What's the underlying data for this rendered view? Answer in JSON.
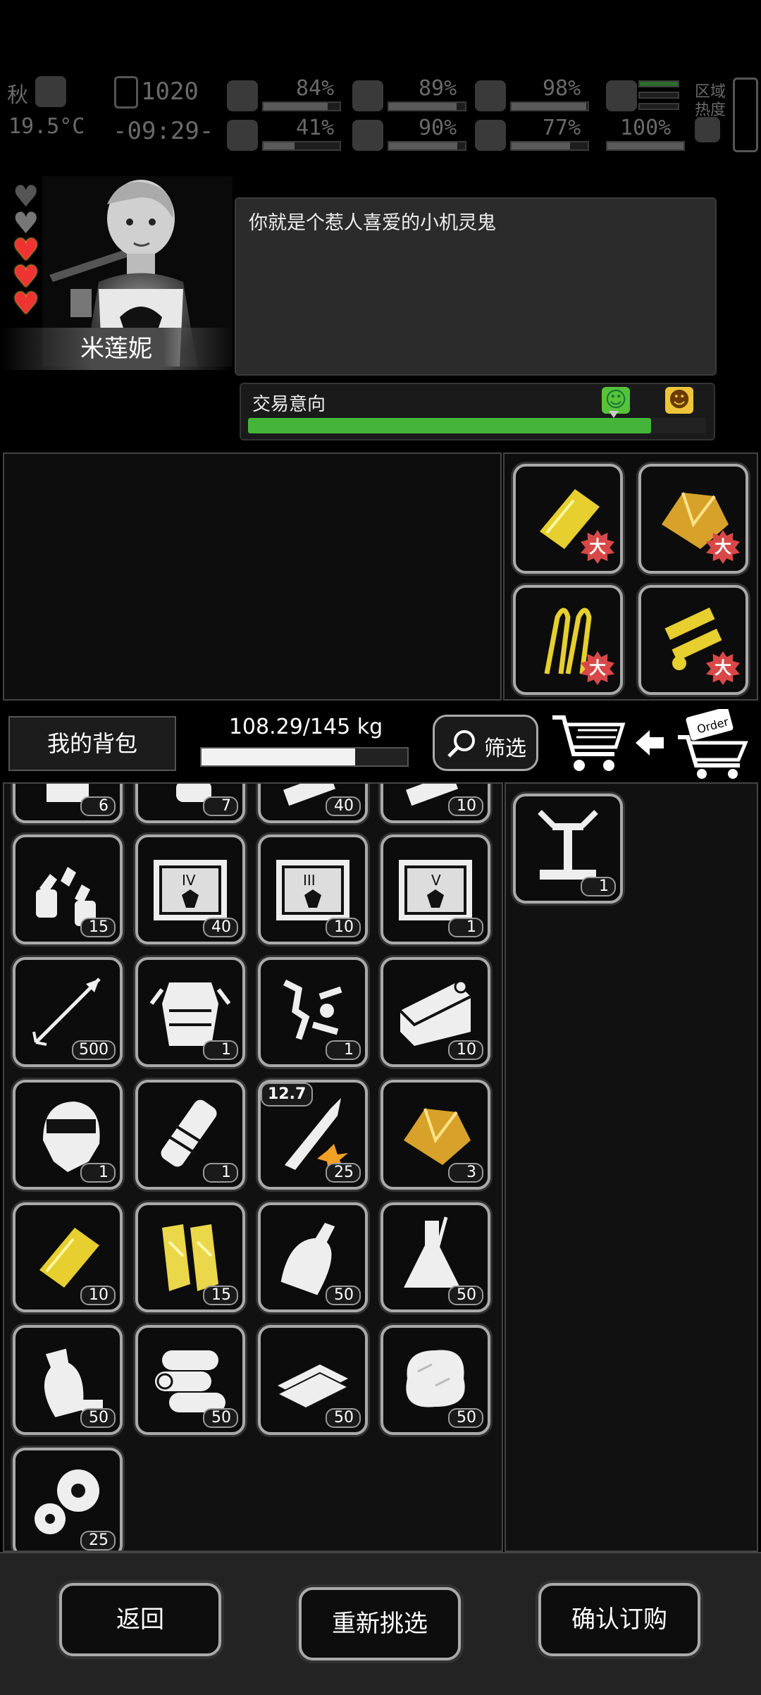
{
  "status": {
    "season": "秋",
    "time_digits": "1020",
    "temperature": "19.5°C",
    "clock": "-09:29-",
    "stats_top": [
      "84%",
      "89%",
      "98%"
    ],
    "stats_bottom": [
      "41%",
      "90%",
      "77%",
      "100%"
    ],
    "area_heat_label": "区域\n热度"
  },
  "character": {
    "name": "米莲妮",
    "hearts": [
      "empty",
      "half",
      "full",
      "full",
      "full"
    ],
    "dialog": "你就是个惹人喜爱的小机灵鬼"
  },
  "trade": {
    "label": "交易意向",
    "level": 0.88
  },
  "offer_items": [
    {
      "icon": "gold-plate-icon",
      "badge": "大"
    },
    {
      "icon": "gold-ore-icon",
      "badge": "大"
    },
    {
      "icon": "gold-wire-icon",
      "badge": "大"
    },
    {
      "icon": "gold-parts-icon",
      "badge": "大"
    }
  ],
  "toolbar": {
    "bag_label": "我的背包",
    "weight_text": "108.29/145 kg",
    "weight_fraction": 0.747,
    "filter_label": "筛选",
    "order_label": "Order"
  },
  "inventory": {
    "partial_counts": [
      "6",
      "7",
      "40",
      "10"
    ],
    "rows": [
      [
        {
          "icon": "bottles-icon",
          "count": "15"
        },
        {
          "icon": "crate-iv-icon",
          "count": "40"
        },
        {
          "icon": "crate-iii-icon",
          "count": "10"
        },
        {
          "icon": "crate-v-icon",
          "count": "1"
        }
      ],
      [
        {
          "icon": "arrow-icon",
          "count": "500"
        },
        {
          "icon": "body-armor-icon",
          "count": "1"
        },
        {
          "icon": "scrap-parts-icon",
          "count": "1"
        },
        {
          "icon": "canned-food-icon",
          "count": "10"
        }
      ],
      [
        {
          "icon": "helmet-icon",
          "count": "1"
        },
        {
          "icon": "scope-icon",
          "count": "1"
        },
        {
          "icon": "bullet-icon",
          "count": "25",
          "caliber": "12.7"
        },
        {
          "icon": "gold-ore-icon",
          "count": "3"
        }
      ],
      [
        {
          "icon": "gold-plate-icon",
          "count": "10"
        },
        {
          "icon": "gold-strips-icon",
          "count": "15"
        },
        {
          "icon": "bottle-icon",
          "count": "50"
        },
        {
          "icon": "flask-icon",
          "count": "50"
        }
      ],
      [
        {
          "icon": "plastic-bottle-icon",
          "count": "50"
        },
        {
          "icon": "logs-icon",
          "count": "50"
        },
        {
          "icon": "planks-icon",
          "count": "50"
        },
        {
          "icon": "cotton-icon",
          "count": "50"
        }
      ],
      [
        {
          "icon": "gears-icon",
          "count": "25"
        }
      ]
    ],
    "selected": [
      {
        "icon": "robot-arm-icon",
        "count": "1"
      }
    ]
  },
  "buttons": {
    "back": "返回",
    "reselect": "重新挑选",
    "confirm": "确认订购"
  }
}
